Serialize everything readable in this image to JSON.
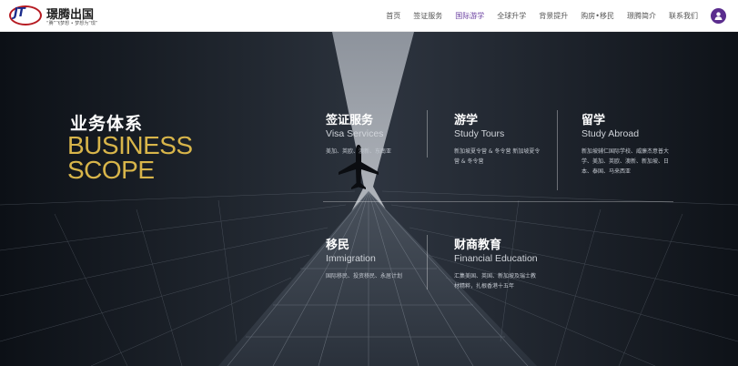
{
  "brand": {
    "logo_letters": "JT",
    "name": "璟腾出国",
    "slogan": "“腾”飞梦想 • 梦想为“璟”"
  },
  "nav": {
    "items": [
      {
        "label": "首页",
        "active": false
      },
      {
        "label": "签证服务",
        "active": false
      },
      {
        "label": "国际游学",
        "active": true
      },
      {
        "label": "全球升学",
        "active": false
      },
      {
        "label": "背景提升",
        "active": false
      },
      {
        "label": "购房•移民",
        "active": false
      },
      {
        "label": "璟腾简介",
        "active": false
      },
      {
        "label": "联系我们",
        "active": false
      }
    ]
  },
  "hero": {
    "title_cn": "业务体系",
    "title_en_line1": "BUSINESS",
    "title_en_line2": "SCOPE",
    "title_en_color": "#d8b54a",
    "plane_icon": "airplane-icon"
  },
  "services": {
    "visa": {
      "title_cn": "签证服务",
      "title_en": "Visa Services",
      "desc": "美加、英欧、澳新、东南亚"
    },
    "tours": {
      "title_cn": "游学",
      "title_en": "Study Tours",
      "desc": "新加坡夏令营 & 冬令营 新加坡夏令营 & 冬令营"
    },
    "abroad": {
      "title_cn": "留学",
      "title_en": "Study Abroad",
      "desc": "新加坡辅仁国际学校、威廉杰意普大学、美加、英欧、澳新、新加坡、日本、泰国、马来西亚"
    },
    "immigration": {
      "title_cn": "移民",
      "title_en": "Immigration",
      "desc": "国际移民、投资移民、永居计划"
    },
    "education": {
      "title_cn": "财商教育",
      "title_en": "Financial Education",
      "desc": "汇集美国、英国、新加坡及瑞士教材精粹，扎根香港十五年"
    }
  },
  "colors": {
    "accent_purple": "#5b2d8e",
    "nav_active": "#6a3fa0",
    "logo_red": "#b61b22",
    "logo_blue": "#1b2c8c"
  }
}
